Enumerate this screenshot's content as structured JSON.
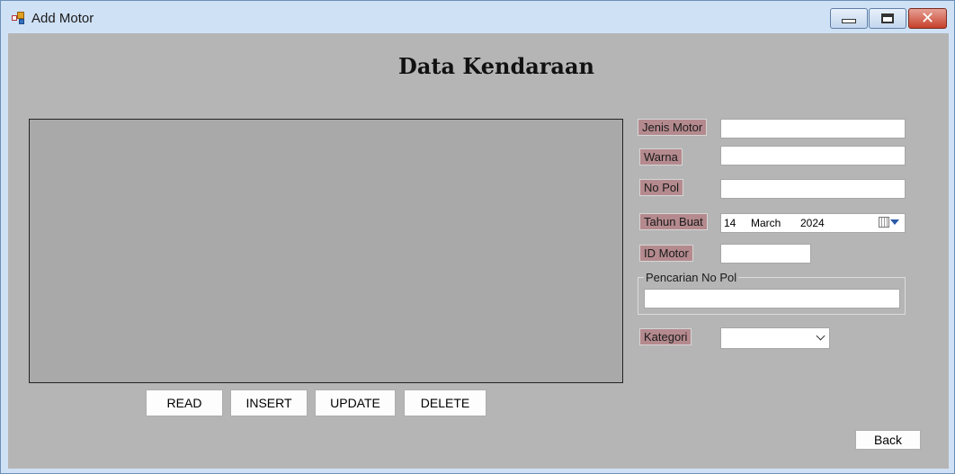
{
  "window": {
    "title": "Add Motor",
    "controls": {
      "minimize": "minimize",
      "maximize": "maximize",
      "close": "close"
    }
  },
  "heading": "Data Kendaraan",
  "form": {
    "jenis_motor_label": "Jenis Motor",
    "jenis_motor_value": "",
    "warna_label": "Warna",
    "warna_value": "",
    "no_pol_label": "No Pol",
    "no_pol_value": "",
    "tahun_buat_label": "Tahun Buat",
    "tahun_buat": {
      "day": "14",
      "month": "March",
      "year": "2024"
    },
    "id_motor_label": "ID Motor",
    "id_motor_value": "",
    "search_group_title": "Pencarian No Pol",
    "search_value": "",
    "kategori_label": "Kategori",
    "kategori_value": ""
  },
  "buttons": {
    "read": "READ",
    "insert": "INSERT",
    "update": "UPDATE",
    "delete": "DELETE",
    "back": "Back"
  },
  "colors": {
    "form_background": "#b5b5b5",
    "grid_background": "#a9a9a9",
    "label_background": "#b48a8e",
    "titlebar": "#cfe1f5",
    "close_button": "#c7412c"
  },
  "icons": {
    "app": "app-icon",
    "calendar": "calendar-icon",
    "dropdown": "chevron-down-icon"
  }
}
